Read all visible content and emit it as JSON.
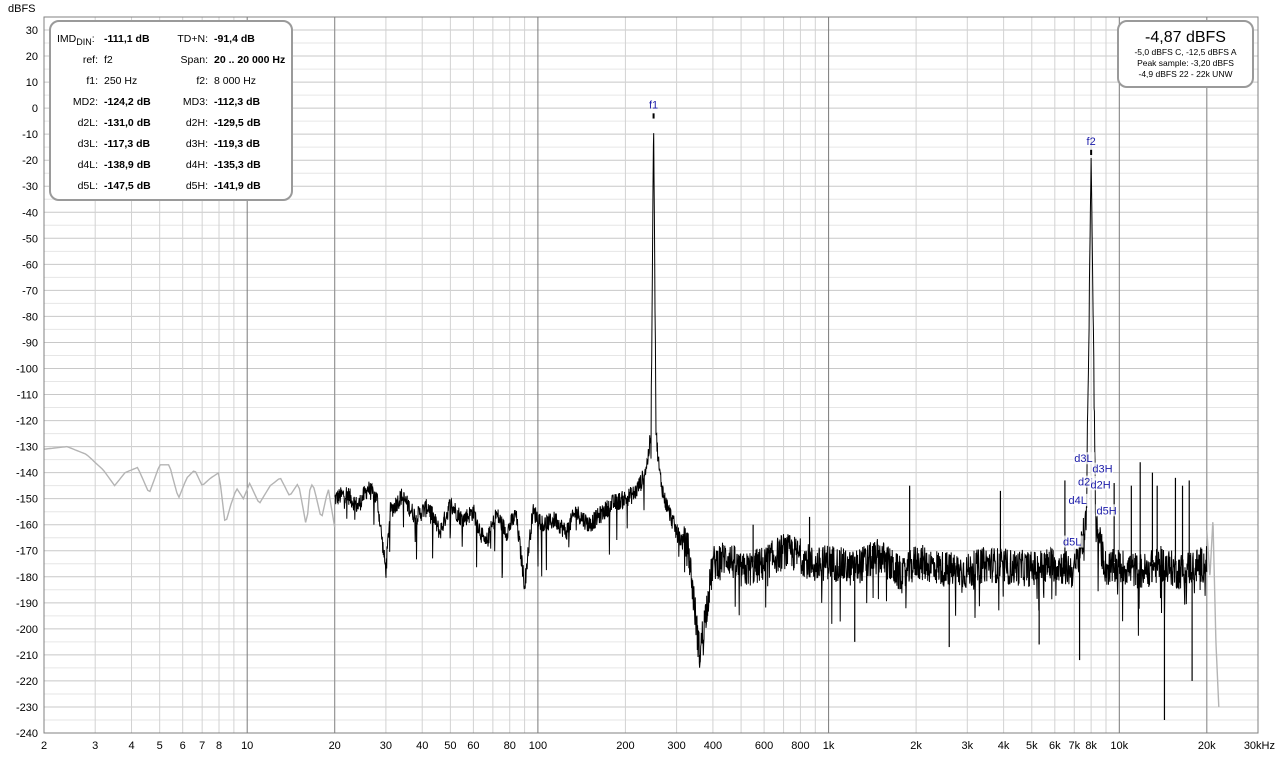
{
  "chart_data": {
    "type": "line",
    "ylabel": "dBFS",
    "x_scale": "log",
    "xlim": [
      2,
      30000
    ],
    "ylim": [
      -240,
      35
    ],
    "grid": true,
    "y_ticks": [
      "30",
      "20",
      "10",
      "0",
      "-10",
      "-20",
      "-30",
      "-40",
      "-50",
      "-60",
      "-70",
      "-80",
      "-90",
      "-100",
      "-110",
      "-120",
      "-130",
      "-140",
      "-150",
      "-160",
      "-170",
      "-180",
      "-190",
      "-200",
      "-210",
      "-220",
      "-230",
      "-240"
    ],
    "x_ticks": [
      {
        "value": 2,
        "label": "2"
      },
      {
        "value": 3,
        "label": "3"
      },
      {
        "value": 4,
        "label": "4"
      },
      {
        "value": 5,
        "label": "5"
      },
      {
        "value": 6,
        "label": "6"
      },
      {
        "value": 7,
        "label": "7"
      },
      {
        "value": 8,
        "label": "8"
      },
      {
        "value": 10,
        "label": "10"
      },
      {
        "value": 20,
        "label": "20"
      },
      {
        "value": 30,
        "label": "30"
      },
      {
        "value": 40,
        "label": "40"
      },
      {
        "value": 50,
        "label": "50"
      },
      {
        "value": 60,
        "label": "60"
      },
      {
        "value": 80,
        "label": "80"
      },
      {
        "value": 100,
        "label": "100"
      },
      {
        "value": 200,
        "label": "200"
      },
      {
        "value": 300,
        "label": "300"
      },
      {
        "value": 400,
        "label": "400"
      },
      {
        "value": 600,
        "label": "600"
      },
      {
        "value": 800,
        "label": "800"
      },
      {
        "value": 1000,
        "label": "1k"
      },
      {
        "value": 2000,
        "label": "2k"
      },
      {
        "value": 3000,
        "label": "3k"
      },
      {
        "value": 4000,
        "label": "4k"
      },
      {
        "value": 5000,
        "label": "5k"
      },
      {
        "value": 6000,
        "label": "6k"
      },
      {
        "value": 7000,
        "label": "7k"
      },
      {
        "value": 8000,
        "label": "8k"
      },
      {
        "value": 10000,
        "label": "10k"
      },
      {
        "value": 20000,
        "label": "20k"
      },
      {
        "value": 30000,
        "label": "30kHz"
      }
    ],
    "series": [
      {
        "color": "#b4b4b4",
        "points": [
          [
            2,
            -131
          ],
          [
            2.4,
            -130
          ],
          [
            2.8,
            -133
          ],
          [
            3.2,
            -139
          ],
          [
            3.5,
            -145
          ],
          [
            3.8,
            -140
          ],
          [
            4.2,
            -138
          ],
          [
            4.6,
            -148
          ],
          [
            5,
            -137
          ],
          [
            5.4,
            -137
          ],
          [
            5.8,
            -150
          ],
          [
            6.2,
            -142
          ],
          [
            6.6,
            -139
          ],
          [
            7,
            -145
          ],
          [
            7.5,
            -142
          ],
          [
            8,
            -140
          ],
          [
            8.4,
            -160
          ],
          [
            8.8,
            -152
          ],
          [
            9.2,
            -146
          ],
          [
            9.7,
            -150
          ],
          [
            10.2,
            -144
          ],
          [
            11,
            -152
          ],
          [
            12,
            -145
          ],
          [
            13,
            -142
          ],
          [
            14,
            -149
          ],
          [
            15,
            -144
          ],
          [
            16,
            -161
          ],
          [
            16.5,
            -144
          ],
          [
            17,
            -146
          ],
          [
            18,
            -158
          ],
          [
            19,
            -146
          ],
          [
            20,
            -161
          ]
        ]
      },
      {
        "color": "#000000",
        "points": [
          [
            20,
            -150
          ],
          [
            22,
            -148
          ],
          [
            24,
            -153
          ],
          [
            26,
            -146
          ],
          [
            28,
            -150
          ],
          [
            30,
            -178
          ],
          [
            31,
            -155
          ],
          [
            34,
            -149
          ],
          [
            38,
            -157
          ],
          [
            42,
            -153
          ],
          [
            46,
            -163
          ],
          [
            50,
            -152
          ],
          [
            55,
            -158
          ],
          [
            60,
            -155
          ],
          [
            66,
            -168
          ],
          [
            72,
            -156
          ],
          [
            78,
            -163
          ],
          [
            84,
            -156
          ],
          [
            90,
            -183
          ],
          [
            96,
            -155
          ],
          [
            105,
            -160
          ],
          [
            115,
            -158
          ],
          [
            125,
            -163
          ],
          [
            135,
            -155
          ],
          [
            150,
            -160
          ],
          [
            165,
            -156
          ],
          [
            180,
            -152
          ],
          [
            200,
            -150
          ],
          [
            215,
            -148
          ],
          [
            228,
            -143
          ],
          [
            238,
            -136
          ],
          [
            245,
            -125
          ],
          [
            250,
            -4
          ],
          [
            255,
            -125
          ],
          [
            262,
            -140
          ],
          [
            272,
            -150
          ],
          [
            285,
            -156
          ],
          [
            300,
            -163
          ],
          [
            330,
            -170
          ],
          [
            360,
            -210
          ],
          [
            400,
            -175
          ],
          [
            450,
            -172
          ],
          [
            500,
            -178
          ],
          [
            600,
            -175
          ],
          [
            700,
            -170
          ],
          [
            800,
            -172
          ],
          [
            900,
            -176
          ],
          [
            1000,
            -174
          ],
          [
            1200,
            -177
          ],
          [
            1500,
            -172
          ],
          [
            1800,
            -180
          ],
          [
            2000,
            -174
          ],
          [
            2500,
            -177
          ],
          [
            3000,
            -178
          ],
          [
            3500,
            -175
          ],
          [
            4000,
            -176
          ],
          [
            5000,
            -177
          ],
          [
            6000,
            -175
          ],
          [
            7000,
            -178
          ],
          [
            7700,
            -160
          ],
          [
            8000,
            -18
          ],
          [
            8300,
            -160
          ],
          [
            9000,
            -177
          ],
          [
            10000,
            -176
          ],
          [
            12000,
            -178
          ],
          [
            14000,
            -175
          ],
          [
            16000,
            -178
          ],
          [
            18000,
            -176
          ],
          [
            20000,
            -175
          ]
        ]
      },
      {
        "color": "#b4b4b4",
        "points": [
          [
            20000,
            -162
          ],
          [
            20500,
            -180
          ],
          [
            21000,
            -158
          ],
          [
            21500,
            -205
          ],
          [
            22000,
            -230
          ]
        ]
      }
    ],
    "peak_lines": [
      {
        "x": 250,
        "y": -4
      },
      {
        "x": 8000,
        "y": -18
      },
      {
        "x": 1900,
        "y": -145
      },
      {
        "x": 3900,
        "y": -147
      },
      {
        "x": 6500,
        "y": -143
      },
      {
        "x": 9600,
        "y": -144
      },
      {
        "x": 11800,
        "y": -136
      },
      {
        "x": 13500,
        "y": -145
      },
      {
        "x": 15600,
        "y": -142
      },
      {
        "x": 17400,
        "y": -143
      },
      {
        "x": 550,
        "y": -160
      },
      {
        "x": 860,
        "y": -157
      },
      {
        "x": 11000,
        "y": -145
      },
      {
        "x": 13000,
        "y": -140
      },
      {
        "x": 16500,
        "y": -145
      }
    ],
    "dips": [
      {
        "x": 360,
        "y": -210
      },
      {
        "x": 14300,
        "y": -235
      },
      {
        "x": 17800,
        "y": -220
      },
      {
        "x": 1230,
        "y": -205
      },
      {
        "x": 2600,
        "y": -207
      },
      {
        "x": 5300,
        "y": -206
      },
      {
        "x": 7300,
        "y": -212
      }
    ],
    "markers": [
      {
        "label": "f1",
        "x": 250,
        "y": -4
      },
      {
        "label": "f2",
        "x": 8000,
        "y": -18
      }
    ],
    "harmonic_markers": [
      {
        "label": "d3L",
        "x": 7000,
        "y": -136
      },
      {
        "label": "d3H",
        "x": 8080,
        "y": -140
      },
      {
        "label": "d2L",
        "x": 7210,
        "y": -145
      },
      {
        "label": "d2H",
        "x": 7960,
        "y": -146
      },
      {
        "label": "d4L",
        "x": 6690,
        "y": -152
      },
      {
        "label": "d5H",
        "x": 8350,
        "y": -156
      },
      {
        "label": "d5L",
        "x": 6400,
        "y": -168
      }
    ]
  },
  "imd_panel": {
    "imd_label": "IMD",
    "imd_sub": "DIN",
    "imd_colon": ":",
    "rows": [
      {
        "l_label": "IMD",
        "l_value": "-111,1 dB",
        "r_label": "TD+N:",
        "r_value": "-91,4 dB",
        "bold": true
      },
      {
        "l_label": "ref:",
        "l_value": "f2",
        "r_label": "Span:",
        "r_value": "20 .. 20 000 Hz",
        "bold": false,
        "r_bold": true
      },
      {
        "l_label": "f1:",
        "l_value": "250 Hz",
        "r_label": "f2:",
        "r_value": "8 000 Hz",
        "bold": false
      },
      {
        "l_label": "MD2:",
        "l_value": "-124,2 dB",
        "r_label": "MD3:",
        "r_value": "-112,3 dB",
        "bold": true
      },
      {
        "l_label": "d2L:",
        "l_value": "-131,0 dB",
        "r_label": "d2H:",
        "r_value": "-129,5 dB",
        "bold": true
      },
      {
        "l_label": "d3L:",
        "l_value": "-117,3 dB",
        "r_label": "d3H:",
        "r_value": "-119,3 dB",
        "bold": true
      },
      {
        "l_label": "d4L:",
        "l_value": "-138,9 dB",
        "r_label": "d4H:",
        "r_value": "-135,3 dB",
        "bold": true
      },
      {
        "l_label": "d5L:",
        "l_value": "-147,5 dB",
        "r_label": "d5H:",
        "r_value": "-141,9 dB",
        "bold": true
      }
    ]
  },
  "level_panel": {
    "main": "-4,87 dBFS",
    "line1": "-5,0 dBFS C, -12,5 dBFS A",
    "line2": "Peak sample: -3,20 dBFS",
    "line3": "-4,9 dBFS 22 - 22k UNW"
  }
}
